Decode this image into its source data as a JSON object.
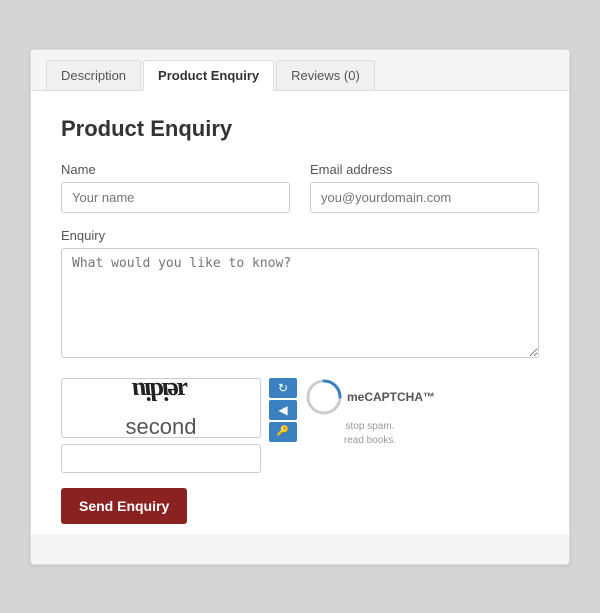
{
  "tabs": [
    {
      "label": "Description",
      "active": false
    },
    {
      "label": "Product Enquiry",
      "active": true
    },
    {
      "label": "Reviews (0)",
      "active": false
    }
  ],
  "form": {
    "title": "Product Enquiry",
    "name_label": "Name",
    "name_placeholder": "Your name",
    "email_label": "Email address",
    "email_placeholder": "you@yourdomain.com",
    "enquiry_label": "Enquiry",
    "enquiry_placeholder": "What would you like to know?",
    "captcha_text1": "ɹeidiu",
    "captcha_text2": "second",
    "captcha_refresh_icon": "↻",
    "captcha_audio_icon": "◀",
    "captcha_key_icon": "⚿",
    "mecaptcha_label": "meCAPTCHA™",
    "mecaptcha_stop_spam": "stop spam.",
    "mecaptcha_read_books": "read books.",
    "captcha_input_placeholder": "",
    "send_button_label": "Send Enquiry"
  }
}
